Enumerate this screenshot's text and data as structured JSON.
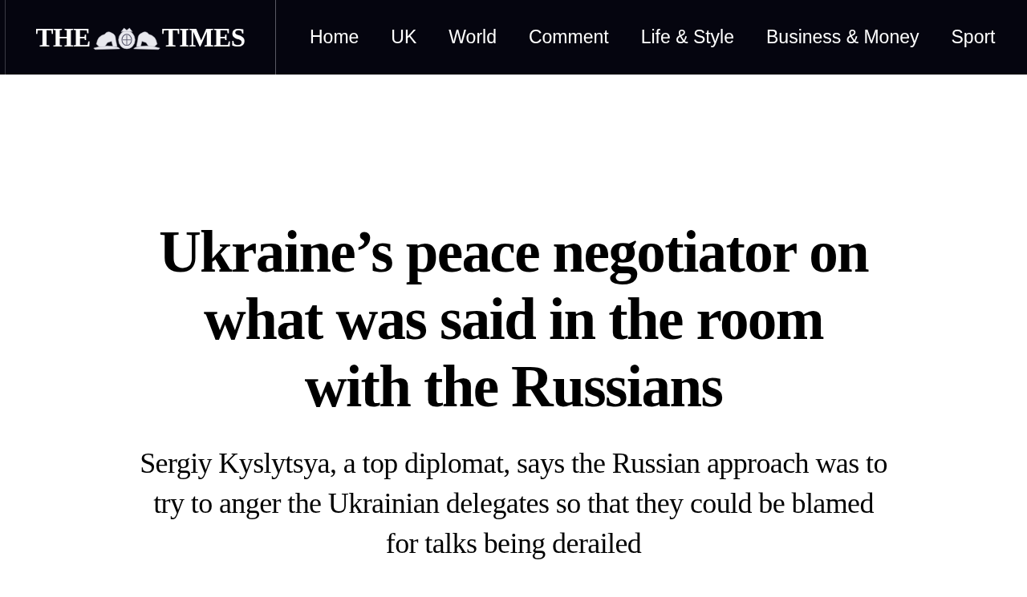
{
  "masthead": {
    "logo": {
      "left": "THE",
      "right": "TIMES"
    },
    "nav": [
      {
        "label": "Home"
      },
      {
        "label": "UK"
      },
      {
        "label": "World"
      },
      {
        "label": "Comment"
      },
      {
        "label": "Life & Style"
      },
      {
        "label": "Business & Money"
      },
      {
        "label": "Sport"
      }
    ]
  },
  "article": {
    "headline": "Ukraine’s peace negotiator on what was said in the room with the Russians",
    "standfirst": "Sergiy Kyslytsya, a top diplomat, says the Russian approach was to try to anger the Ukrainian delegates so that they could be blamed for talks being derailed"
  }
}
